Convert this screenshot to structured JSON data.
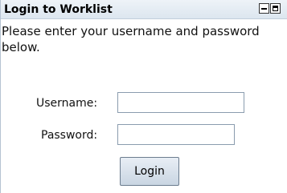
{
  "panel": {
    "title": "Login to Worklist",
    "minimize_icon": "minimize-icon",
    "maximize_icon": "maximize-icon"
  },
  "form": {
    "instructions": "Please enter your username and password below.",
    "username_label": "Username:",
    "username_value": "",
    "password_label": "Password:",
    "password_value": "",
    "submit_label": "Login"
  }
}
